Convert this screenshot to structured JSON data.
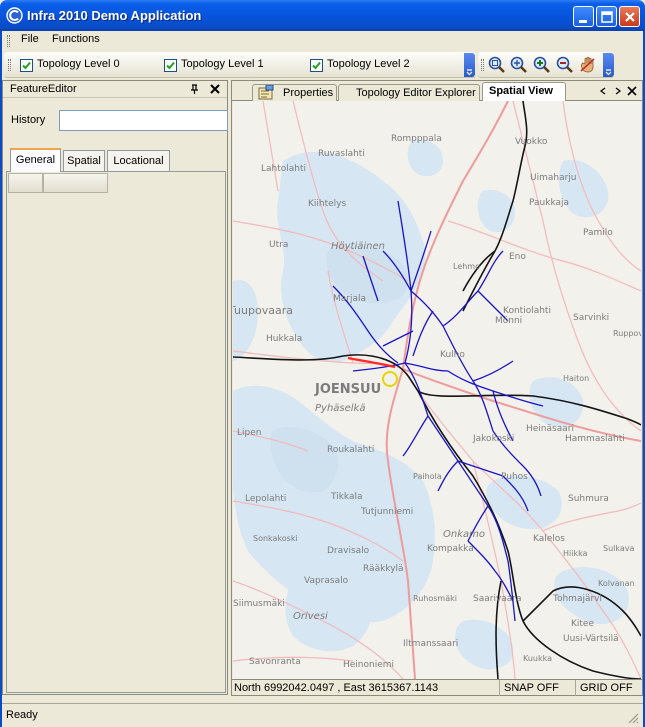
{
  "window": {
    "title": "Infra 2010 Demo Application"
  },
  "menu": {
    "items": [
      "File",
      "Functions"
    ]
  },
  "toolbar": {
    "layers": [
      {
        "label": "Topology Level 0",
        "checked": true
      },
      {
        "label": "Topology Level 1",
        "checked": true
      },
      {
        "label": "Topology Level 2",
        "checked": true
      }
    ],
    "tools": [
      "zoom-area-icon",
      "zoom-fit-icon",
      "zoom-in-icon",
      "zoom-out-icon",
      "pan-hand-icon"
    ]
  },
  "feature_editor": {
    "title": "FeatureEditor",
    "history_label": "History",
    "history_value": "",
    "tabs": [
      "General",
      "Spatial",
      "Locational"
    ],
    "active_tab": "General"
  },
  "document_tabs": {
    "items": [
      "Properties",
      "Topology Editor Explorer",
      "Spatial View"
    ],
    "active": "Spatial View"
  },
  "map": {
    "place_labels": [
      "Rompppala",
      "Ruvaslahti",
      "Lahtolahti",
      "Kiihtelys",
      "Utra",
      "Kulho",
      "Marjala",
      "Tuupovaara",
      "Uimaharju",
      "Vuokko",
      "Paukkaja",
      "Pamilo",
      "Eno",
      "Sarvinki",
      "Mönni",
      "JOENSUU",
      "Kontiolahti",
      "Hukkala",
      "Lipen",
      "Roukalahti",
      "Lepolahti",
      "Tikkala",
      "Tutjunniemi",
      "Dravisalo",
      "Vaprasalo",
      "Rääkkylä",
      "Kompakka",
      "Saarivaara",
      "Kitee",
      "Heinäsaari",
      "Suhmura",
      "Hammaslahti",
      "Pyhäselkä",
      "Höytiäinen",
      "Savonranta",
      "Heinoniemi",
      "Iltmanssaari",
      "Onkamo",
      "Uusi-Värtsilä",
      "Tohmajärvi",
      "Ruppova",
      "Siimusmäki",
      "Orivesi",
      "Puhos",
      "Kalelos",
      "Haiton",
      "Ruhosmäki",
      "Kuukka",
      "Sulkava",
      "Kolvanan",
      "Sonkakoski",
      "Jakokoski",
      "Hiikka",
      "Paihola",
      "Lehmo"
    ],
    "colors": {
      "water": "#d6e6f3",
      "land": "#f3f1ec",
      "roads": "#f2b9b9",
      "network": "#1a14c8",
      "railway": "#151515",
      "selected": "#ff2a2a"
    }
  },
  "spatial_status": {
    "coords": "North 6992042.0497 , East 3615367.1143",
    "snap": "SNAP OFF",
    "grid": "GRID OFF"
  },
  "status": {
    "text": "Ready"
  }
}
